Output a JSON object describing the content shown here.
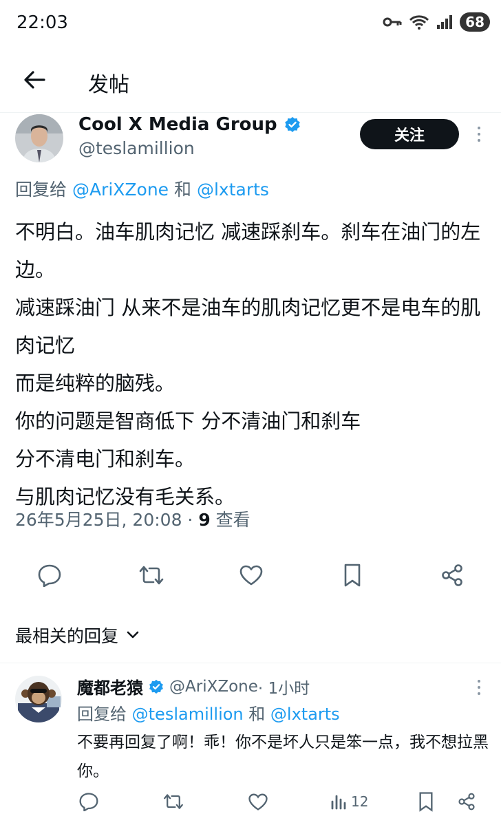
{
  "status_bar": {
    "time": "22:03",
    "battery": "68"
  },
  "header": {
    "title": "发帖"
  },
  "post": {
    "author_name": "Cool X Media Group",
    "author_handle": "@teslamillion",
    "follow_label": "关注",
    "reply_prefix": "回复给 ",
    "reply_mention_1": "@AriXZone",
    "reply_and": " 和 ",
    "reply_mention_2": "@lxtarts",
    "body": "不明白。油车肌肉记忆 减速踩刹车。刹车在油门的左边。\n减速踩油门 从来不是油车的肌肉记忆更不是电车的肌肉记忆\n而是纯粹的脑残。\n你的问题是智商低下 分不清油门和刹车\n分不清电门和刹车。\n与肌肉记忆没有毛关系。",
    "timestamp": "26年5月25日, 20:08 · ",
    "views_count": "9",
    "views_label": " 查看"
  },
  "replies_section": {
    "title": "最相关的回复"
  },
  "reply": {
    "author_name": "魔都老猿",
    "author_handle": "@AriXZone",
    "time_ago": " · 1小时",
    "reply_prefix": "回复给 ",
    "reply_mention_1": "@teslamillion",
    "reply_and": " 和 ",
    "reply_mention_2": "@lxtarts",
    "body": "不要再回复了啊！乖！你不是坏人只是笨一点，我不想拉黑你。",
    "views_count": "12"
  },
  "icons": [
    "back-arrow-icon",
    "verified-badge-icon",
    "more-icon",
    "reply-icon",
    "retweet-icon",
    "like-icon",
    "bookmark-icon",
    "share-icon",
    "chevron-down-icon",
    "views-icon"
  ],
  "colors": {
    "link": "#1d9bf0",
    "verified": "#1d9bf0",
    "text": "#0f1419",
    "secondary": "#536471"
  }
}
